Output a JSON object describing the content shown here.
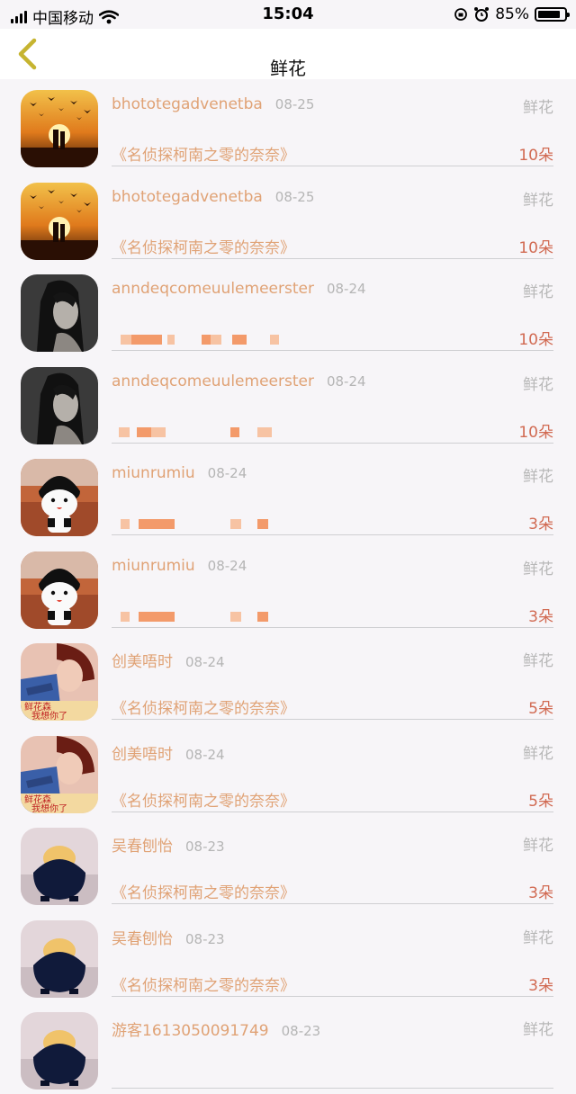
{
  "status_bar": {
    "carrier": "中国移动",
    "time": "15:04",
    "battery": "85%",
    "battery_level": 0.85
  },
  "nav": {
    "title": "鲜花",
    "back_icon": "chevron-left-icon"
  },
  "colors": {
    "name": "#e0a275",
    "count": "#d16a52",
    "muted": "#b8b8b8",
    "nav_back": "#c6b430"
  },
  "items": [
    {
      "name": "bhototegadvenetba",
      "date": "08-25",
      "type": "鲜花",
      "source": "《名侦探柯南之零的奈奈》",
      "count": "10朵"
    },
    {
      "name": "bhototegadvenetba",
      "date": "08-25",
      "type": "鲜花",
      "source": "《名侦探柯南之零的奈奈》",
      "count": "10朵"
    },
    {
      "name": "anndeqcomeuulemeerster",
      "date": "08-24",
      "type": "鲜花",
      "source": "",
      "count": "10朵"
    },
    {
      "name": "anndeqcomeuulemeerster",
      "date": "08-24",
      "type": "鲜花",
      "source": "",
      "count": "10朵"
    },
    {
      "name": "miunrumiu",
      "date": "08-24",
      "type": "鲜花",
      "source": "",
      "count": "3朵"
    },
    {
      "name": "miunrumiu",
      "date": "08-24",
      "type": "鲜花",
      "source": "",
      "count": "3朵"
    },
    {
      "name": "创美唔时",
      "date": "08-24",
      "type": "鲜花",
      "source": "《名侦探柯南之零的奈奈》",
      "count": "5朵"
    },
    {
      "name": "创美唔时",
      "date": "08-24",
      "type": "鲜花",
      "source": "《名侦探柯南之零的奈奈》",
      "count": "5朵"
    },
    {
      "name": "吴春刨怡",
      "date": "08-23",
      "type": "鲜花",
      "source": "《名侦探柯南之零的奈奈》",
      "count": "3朵"
    },
    {
      "name": "吴春刨怡",
      "date": "08-23",
      "type": "鲜花",
      "source": "《名侦探柯南之零的奈奈》",
      "count": "3朵"
    },
    {
      "name": "游客1613050091749",
      "date": "08-23",
      "type": "鲜花",
      "source": "",
      "count": ""
    }
  ]
}
